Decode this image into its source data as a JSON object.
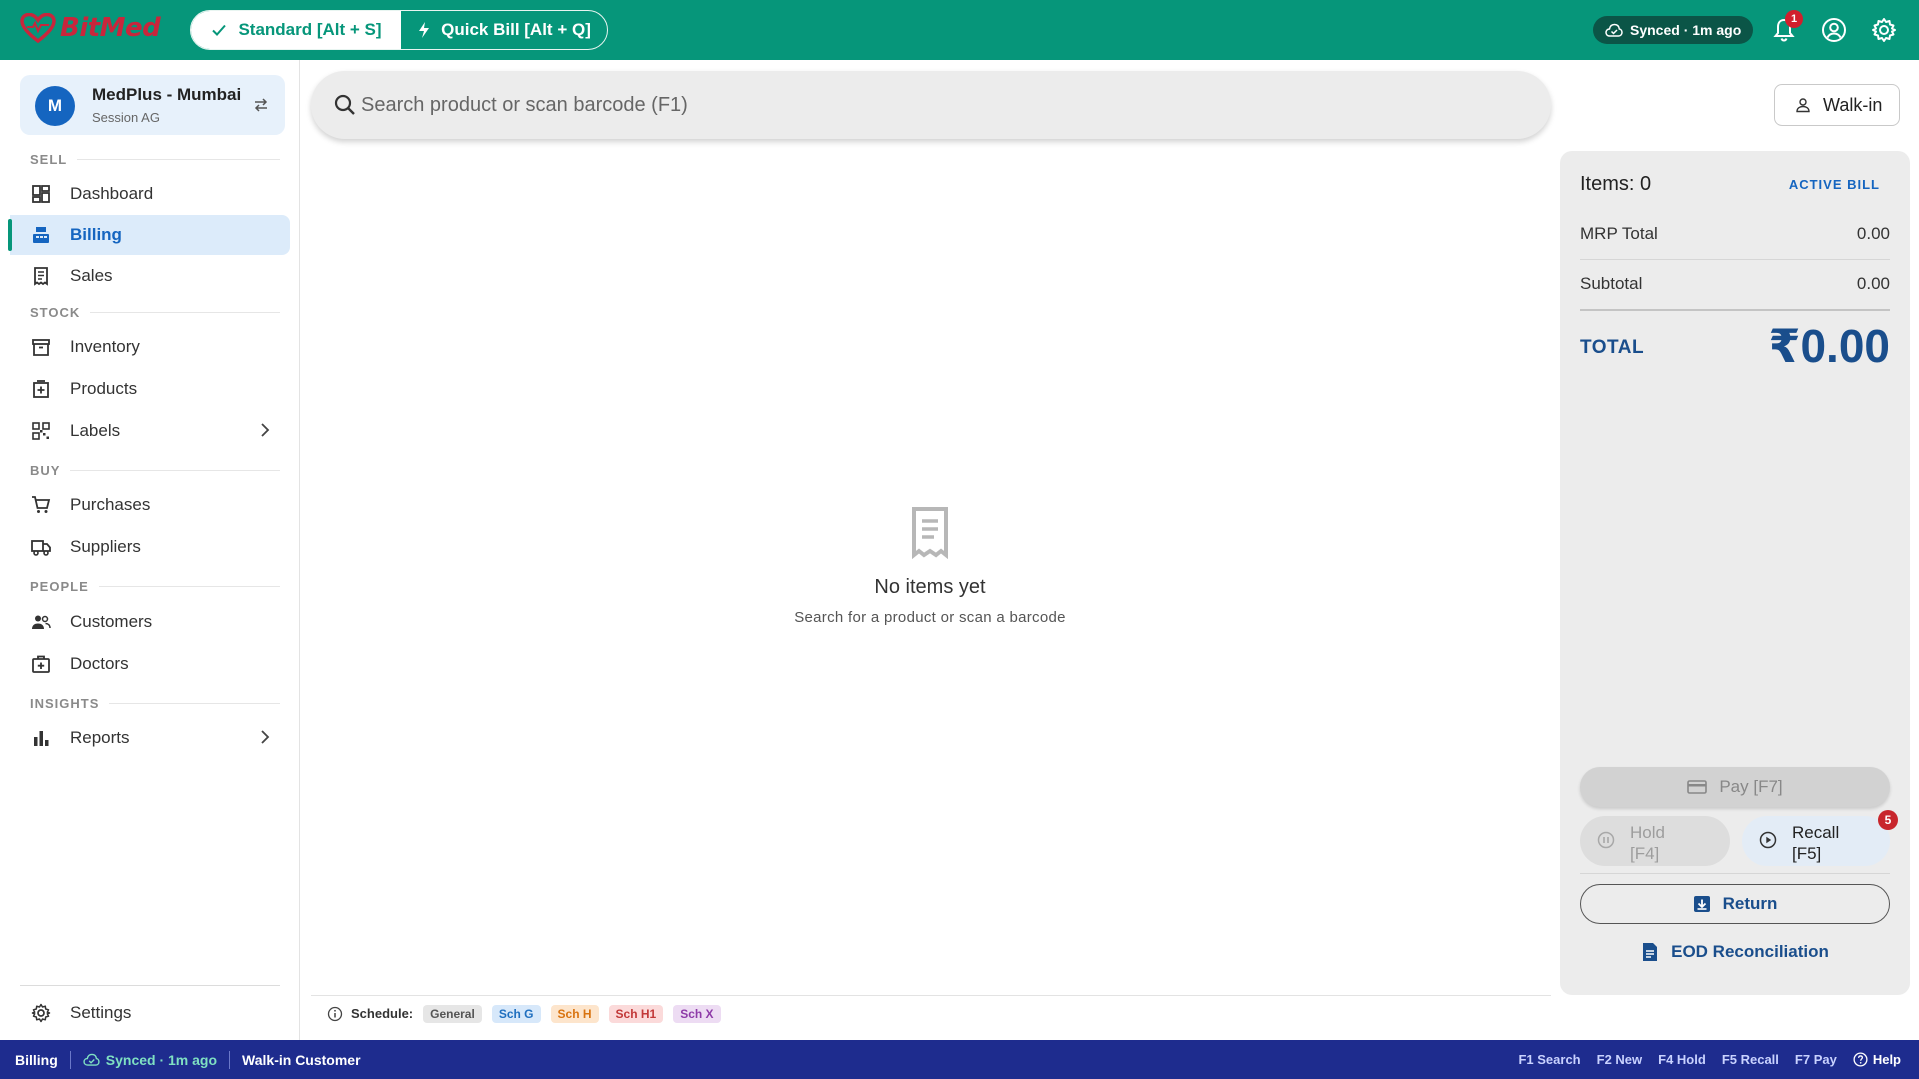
{
  "app": {
    "name": "BitMed"
  },
  "header": {
    "modes": [
      {
        "label": "Standard [Alt + S]",
        "icon": "check-icon"
      },
      {
        "label": "Quick Bill [Alt + Q]",
        "icon": "lightning-icon"
      }
    ],
    "sync": "Synced · 1m ago",
    "notification_count": "1"
  },
  "store": {
    "avatar": "M",
    "name": "MedPlus - Mumbai",
    "session": "Session AG"
  },
  "sidebar": {
    "sections": {
      "sell": "SELL",
      "stock": "STOCK",
      "buy": "BUY",
      "people": "PEOPLE",
      "insights": "INSIGHTS"
    },
    "items": {
      "dashboard": "Dashboard",
      "billing": "Billing",
      "sales": "Sales",
      "inventory": "Inventory",
      "products": "Products",
      "labels": "Labels",
      "purchases": "Purchases",
      "suppliers": "Suppliers",
      "customers": "Customers",
      "doctors": "Doctors",
      "reports": "Reports",
      "settings": "Settings"
    }
  },
  "search": {
    "placeholder": "Search product or scan barcode (F1)"
  },
  "customer_button": "Walk-in",
  "empty_state": {
    "title": "No items yet",
    "subtitle": "Search for a product or scan a barcode"
  },
  "schedule": {
    "label": "Schedule:",
    "chips": [
      {
        "label": "General",
        "bg": "#e6e6e6",
        "fg": "#555555"
      },
      {
        "label": "Sch G",
        "bg": "#d7e8fa",
        "fg": "#1f6fbf"
      },
      {
        "label": "Sch H",
        "bg": "#fde5cc",
        "fg": "#d9730f"
      },
      {
        "label": "Sch H1",
        "bg": "#fbdada",
        "fg": "#c23838"
      },
      {
        "label": "Sch X",
        "bg": "#eddcf3",
        "fg": "#8e3aa8"
      }
    ]
  },
  "bill": {
    "items": "Items: 0",
    "status": "ACTIVE BILL",
    "mrp_label": "MRP Total",
    "mrp_value": "0.00",
    "subtotal_label": "Subtotal",
    "subtotal_value": "0.00",
    "total_label": "TOTAL",
    "total_value": "₹0.00",
    "pay": "Pay  [F7]",
    "hold_line1": "Hold",
    "hold_line2": "[F4]",
    "recall_line1": "Recall",
    "recall_line2": "[F5]",
    "recall_count": "5",
    "return": "Return",
    "eod": "EOD Reconciliation"
  },
  "statusbar": {
    "page": "Billing",
    "sync": "Synced · 1m ago",
    "customer": "Walk-in Customer",
    "shortcuts": [
      "F1 Search",
      "F2 New",
      "F4 Hold",
      "F5 Recall",
      "F7 Pay"
    ],
    "help": "Help"
  },
  "colors": {
    "header": "#06967a",
    "brand": "#c8263c",
    "accent": "#1565c0",
    "statusbar": "#1e2c8e"
  }
}
